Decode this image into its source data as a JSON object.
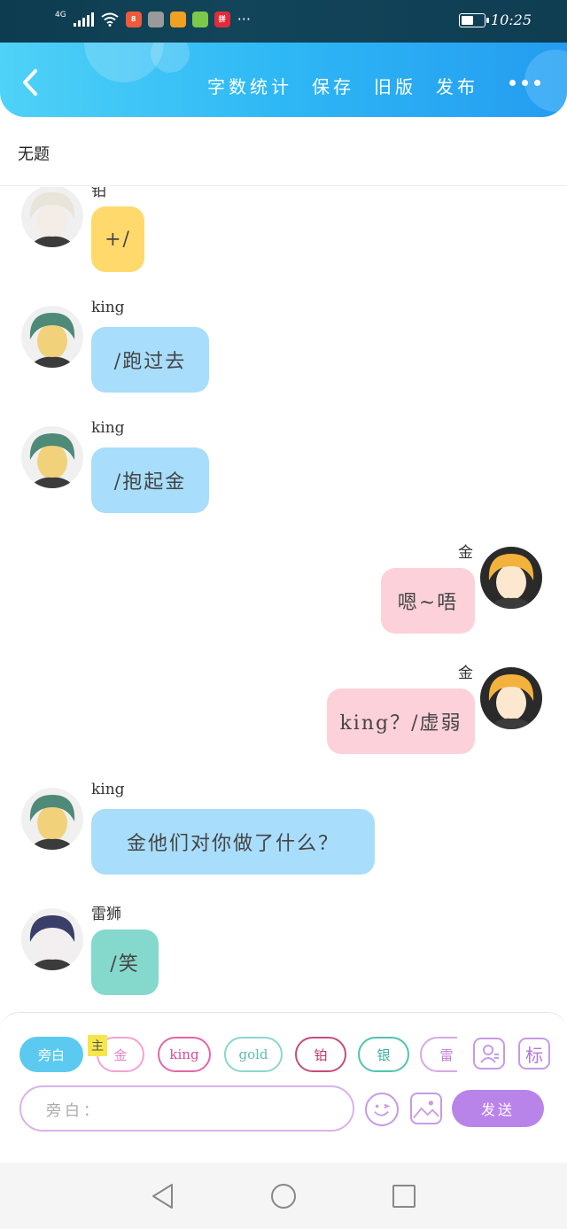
{
  "status_bar": {
    "network": "4G",
    "time": "10:25",
    "battery_level": 0.6,
    "apps": [
      {
        "icon": "red-square-app-icon",
        "color": "#ef5a3c",
        "label": "8"
      },
      {
        "icon": "hex-app-icon",
        "color": "#9a9a9a",
        "label": ""
      },
      {
        "icon": "colorful-app-icon",
        "color": "#f2a024",
        "label": ""
      },
      {
        "icon": "pineapple-app-icon",
        "color": "#7cc84a",
        "label": ""
      },
      {
        "icon": "pinduoduo-app-icon",
        "color": "#e02c3a",
        "label": "拼"
      }
    ],
    "more": "···"
  },
  "header": {
    "back": "back-icon",
    "actions": [
      "字数统计",
      "保存",
      "旧版",
      "发布"
    ],
    "more": "more-icon"
  },
  "title": "无题",
  "messages": [
    {
      "side": "left",
      "name": "铂",
      "text": "+/",
      "color": "#ffd96b",
      "avatar": "avatar-bo",
      "avatar_hair": "#e9e4da",
      "avatar_skin": "#f4ece6"
    },
    {
      "side": "left",
      "name": "king",
      "text": "/跑过去",
      "color": "#a8ddfb",
      "avatar": "avatar-king",
      "avatar_hair": "#4e8a78",
      "avatar_skin": "#f1d17a"
    },
    {
      "side": "left",
      "name": "king",
      "text": "/抱起金",
      "color": "#a8ddfb",
      "avatar": "avatar-king",
      "avatar_hair": "#4e8a78",
      "avatar_skin": "#f1d17a"
    },
    {
      "side": "right",
      "name": "金",
      "text": "嗯~唔",
      "color": "#fdd1da",
      "avatar": "avatar-jin",
      "avatar_hair": "#f2b23d",
      "avatar_skin": "#fbe8cf"
    },
    {
      "side": "right",
      "name": "金",
      "text": "king？/虚弱",
      "color": "#fdd1da",
      "avatar": "avatar-jin",
      "avatar_hair": "#f2b23d",
      "avatar_skin": "#fbe8cf"
    },
    {
      "side": "left",
      "name": "king",
      "text": "金他们对你做了什么？",
      "color": "#a8ddfb",
      "avatar": "avatar-king",
      "avatar_hair": "#4e8a78",
      "avatar_skin": "#f1d17a"
    },
    {
      "side": "left",
      "name": "雷狮",
      "text": "/笑",
      "color": "#85d8cc",
      "avatar": "avatar-leishi",
      "avatar_hair": "#3a3f6a",
      "avatar_skin": "#f3eef0"
    }
  ],
  "composer": {
    "role_chips": [
      {
        "label": "旁白",
        "active": true,
        "border": "#5ccaf0",
        "text_color": "#ffffff"
      },
      {
        "label": "金",
        "active": false,
        "border": "#f3a3d4",
        "text_color": "#e884c3"
      },
      {
        "label": "king",
        "active": false,
        "border": "#e466a8",
        "text_color": "#d94b97"
      },
      {
        "label": "gold",
        "active": false,
        "border": "#8cd6cd",
        "text_color": "#5dbdb2"
      },
      {
        "label": "铂",
        "active": false,
        "border": "#c84b7a",
        "text_color": "#b8386a"
      },
      {
        "label": "银",
        "active": false,
        "border": "#4fc4b0",
        "text_color": "#3cae9a"
      },
      {
        "label": "雷",
        "active": false,
        "border": "#d9a7e6",
        "text_color": "#c17ad6"
      }
    ],
    "main_tag": "主",
    "tools": [
      "person-card-icon",
      "标"
    ],
    "input_placeholder": "旁白：",
    "emoji": "emoji-icon",
    "image": "image-icon",
    "send_label": "发送"
  },
  "nav": [
    "back-triangle-icon",
    "home-circle-icon",
    "recents-square-icon"
  ]
}
